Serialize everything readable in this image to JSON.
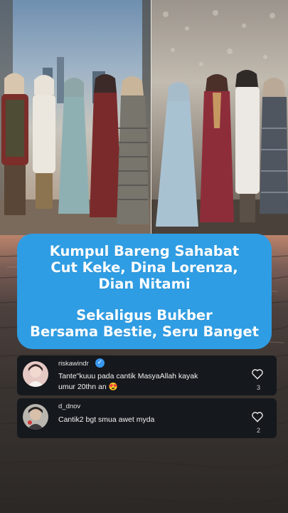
{
  "headline": {
    "lines": [
      "Kumpul Bareng Sahabat",
      "Cut Keke, Dina Lorenza,",
      "Dian Nitami",
      "Sekaligus Bukber",
      "Bersama Bestie, Seru Banget"
    ],
    "color": "#2f9de3"
  },
  "comments": [
    {
      "username": "riskawindr",
      "verified": true,
      "text_line1": "Tante\"kuuu pada cantik MasyaAllah kayak",
      "text_line2": "umur 20thn an 😍",
      "likes": "3",
      "like_icon": "heart-outline-icon"
    },
    {
      "username": "d_dnov",
      "verified": false,
      "text_line1": "Cantik2 bgt smua awet myda",
      "likes": "2",
      "like_icon": "heart-outline-icon"
    }
  ]
}
